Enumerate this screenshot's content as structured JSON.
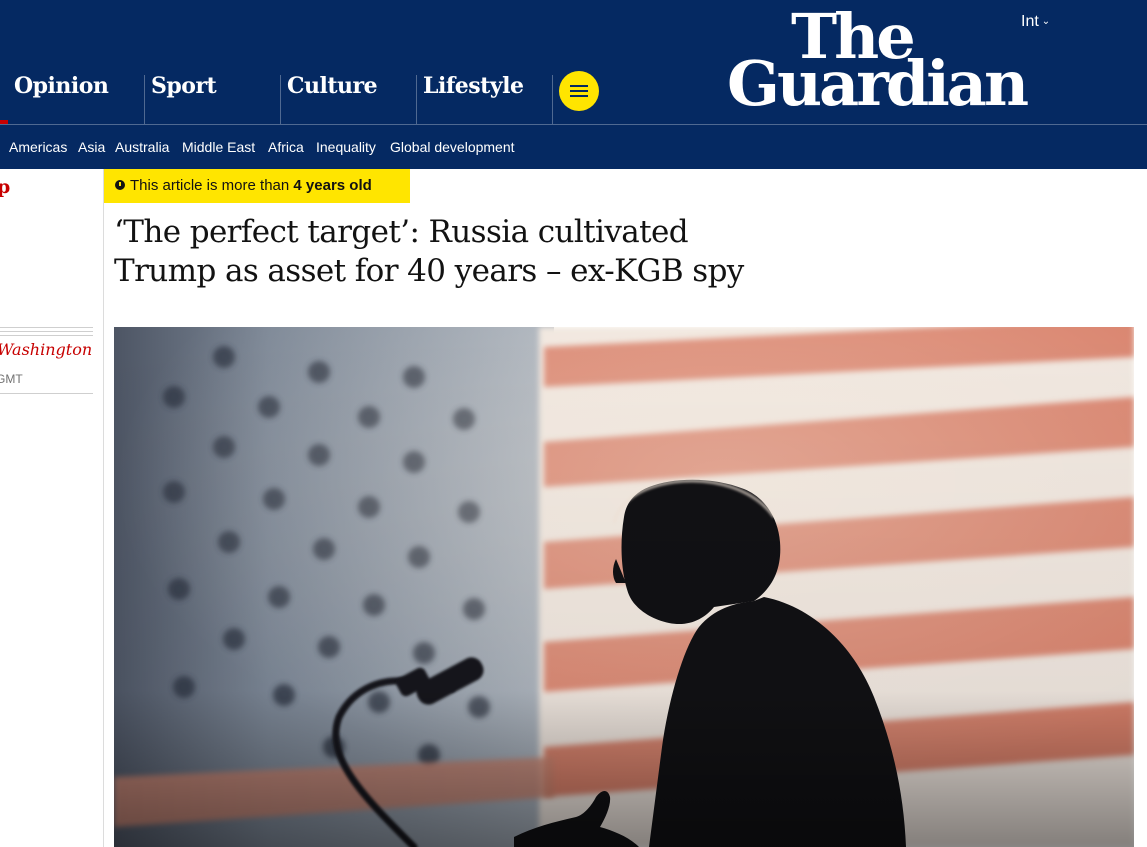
{
  "header": {
    "edition": "Int",
    "logo_line1": "The",
    "logo_line2": "Guardian",
    "pillars": [
      "Opinion",
      "Sport",
      "Culture",
      "Lifestyle"
    ],
    "subnav": [
      "Americas",
      "Asia",
      "Australia",
      "Middle East",
      "Africa",
      "Inequality",
      "Global development"
    ]
  },
  "sidebar": {
    "kicker": "p",
    "dateline": "Washington",
    "time_suffix": "GMT"
  },
  "article": {
    "age_warning_prefix": "This article is more than",
    "age_warning_bold": "4 years old",
    "headline_line1": "‘The perfect target’: Russia cultivated",
    "headline_line2": "Trump as asset for 40 years – ex-KGB spy"
  },
  "colors": {
    "brand_blue": "#052962",
    "accent_yellow": "#ffe500",
    "news_red": "#c70000"
  },
  "icons": [
    "clock-icon",
    "menu-icon",
    "chevron-down-icon"
  ]
}
